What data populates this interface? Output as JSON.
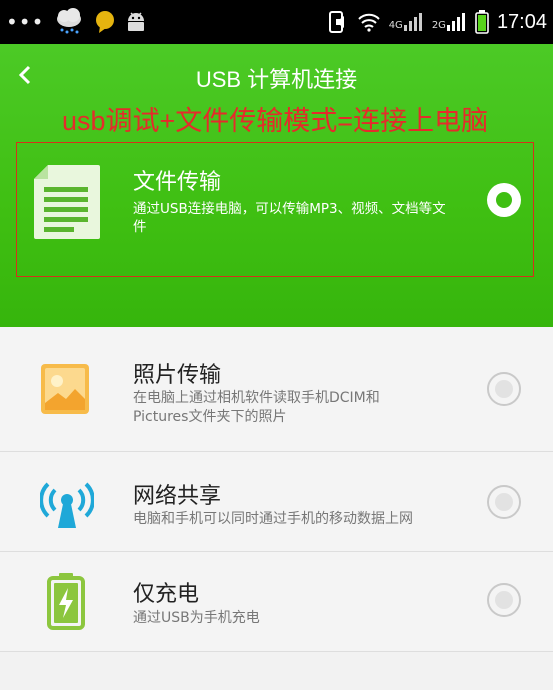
{
  "status_bar": {
    "dots": "•••",
    "sig1_label": "4G",
    "sig2_label": "2G",
    "time": "17:04"
  },
  "header": {
    "title": "USB 计算机连接",
    "back_icon": "chevron-left-icon",
    "annotation": "usb调试+文件传输模式=连接上电脑"
  },
  "options": [
    {
      "title": "文件传输",
      "description": "通过USB连接电脑，可以传输MP3、视频、文档等文件",
      "icon": "document-icon",
      "selected": true
    },
    {
      "title": "照片传输",
      "description": "在电脑上通过相机软件读取手机DCIM和Pictures文件夹下的照片",
      "icon": "photo-icon",
      "selected": false
    },
    {
      "title": "网络共享",
      "description": "电脑和手机可以同时通过手机的移动数据上网",
      "icon": "hotspot-icon",
      "selected": false
    },
    {
      "title": "仅充电",
      "description": "通过USB为手机充电",
      "icon": "battery-charging-icon",
      "selected": false
    }
  ],
  "colors": {
    "header_green": "#3fbf12",
    "annotation_red": "#e52b2b",
    "highlight_border": "#d4321b"
  }
}
